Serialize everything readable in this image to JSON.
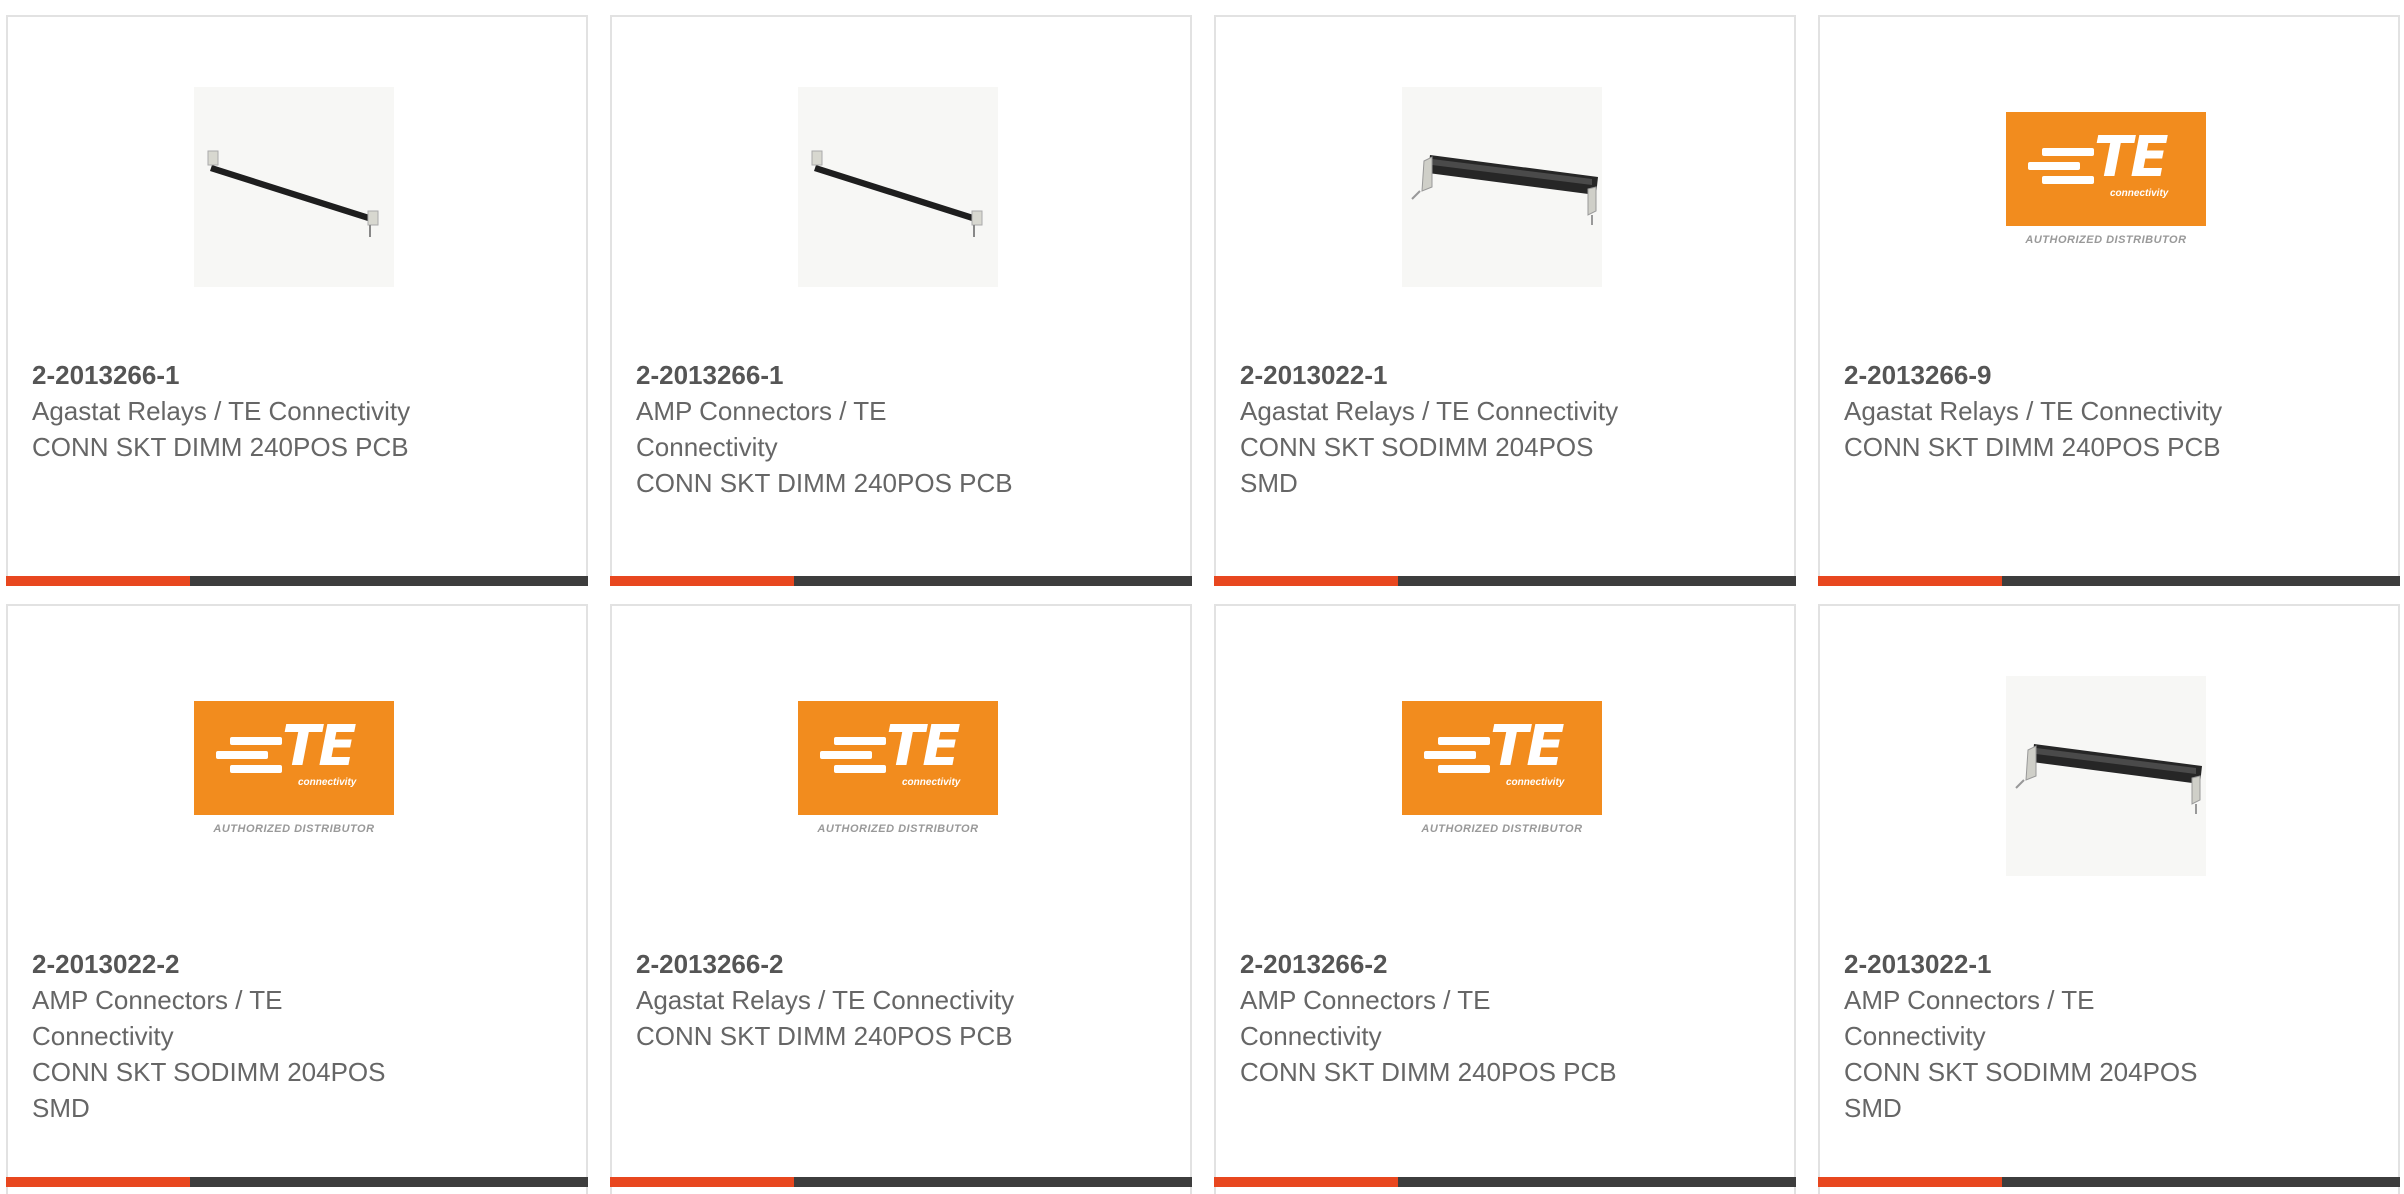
{
  "brand": {
    "accent_color": "#e8471f",
    "bar_color": "#3d3d3d",
    "te_orange": "#f28c1e",
    "te_logo_letters": "TE",
    "te_logo_sub": "connectivity",
    "te_logo_caption": "AUTHORIZED DISTRIBUTOR"
  },
  "products": [
    {
      "part": "2-2013266-1",
      "mfr": "Agastat Relays / TE Connectivity",
      "desc": "CONN SKT DIMM 240POS PCB",
      "image": "connector-photo"
    },
    {
      "part": "2-2013266-1",
      "mfr": "AMP Connectors / TE Connectivity",
      "desc": "CONN SKT DIMM 240POS PCB",
      "image": "connector-photo"
    },
    {
      "part": "2-2013022-1",
      "mfr": "Agastat Relays / TE Connectivity",
      "desc": "CONN SKT SODIMM 204POS SMD",
      "image": "connector-photo"
    },
    {
      "part": "2-2013266-9",
      "mfr": "Agastat Relays / TE Connectivity",
      "desc": "CONN SKT DIMM 240POS PCB",
      "image": "te-logo"
    },
    {
      "part": "2-2013022-2",
      "mfr": "AMP Connectors / TE Connectivity",
      "desc": "CONN SKT SODIMM 204POS SMD",
      "image": "te-logo"
    },
    {
      "part": "2-2013266-2",
      "mfr": "Agastat Relays / TE Connectivity",
      "desc": "CONN SKT DIMM 240POS PCB",
      "image": "te-logo"
    },
    {
      "part": "2-2013266-2",
      "mfr": "AMP Connectors / TE Connectivity",
      "desc": "CONN SKT DIMM 240POS PCB",
      "image": "te-logo"
    },
    {
      "part": "2-2013022-1",
      "mfr": "AMP Connectors / TE Connectivity",
      "desc": "CONN SKT SODIMM 204POS SMD",
      "image": "connector-photo"
    }
  ]
}
